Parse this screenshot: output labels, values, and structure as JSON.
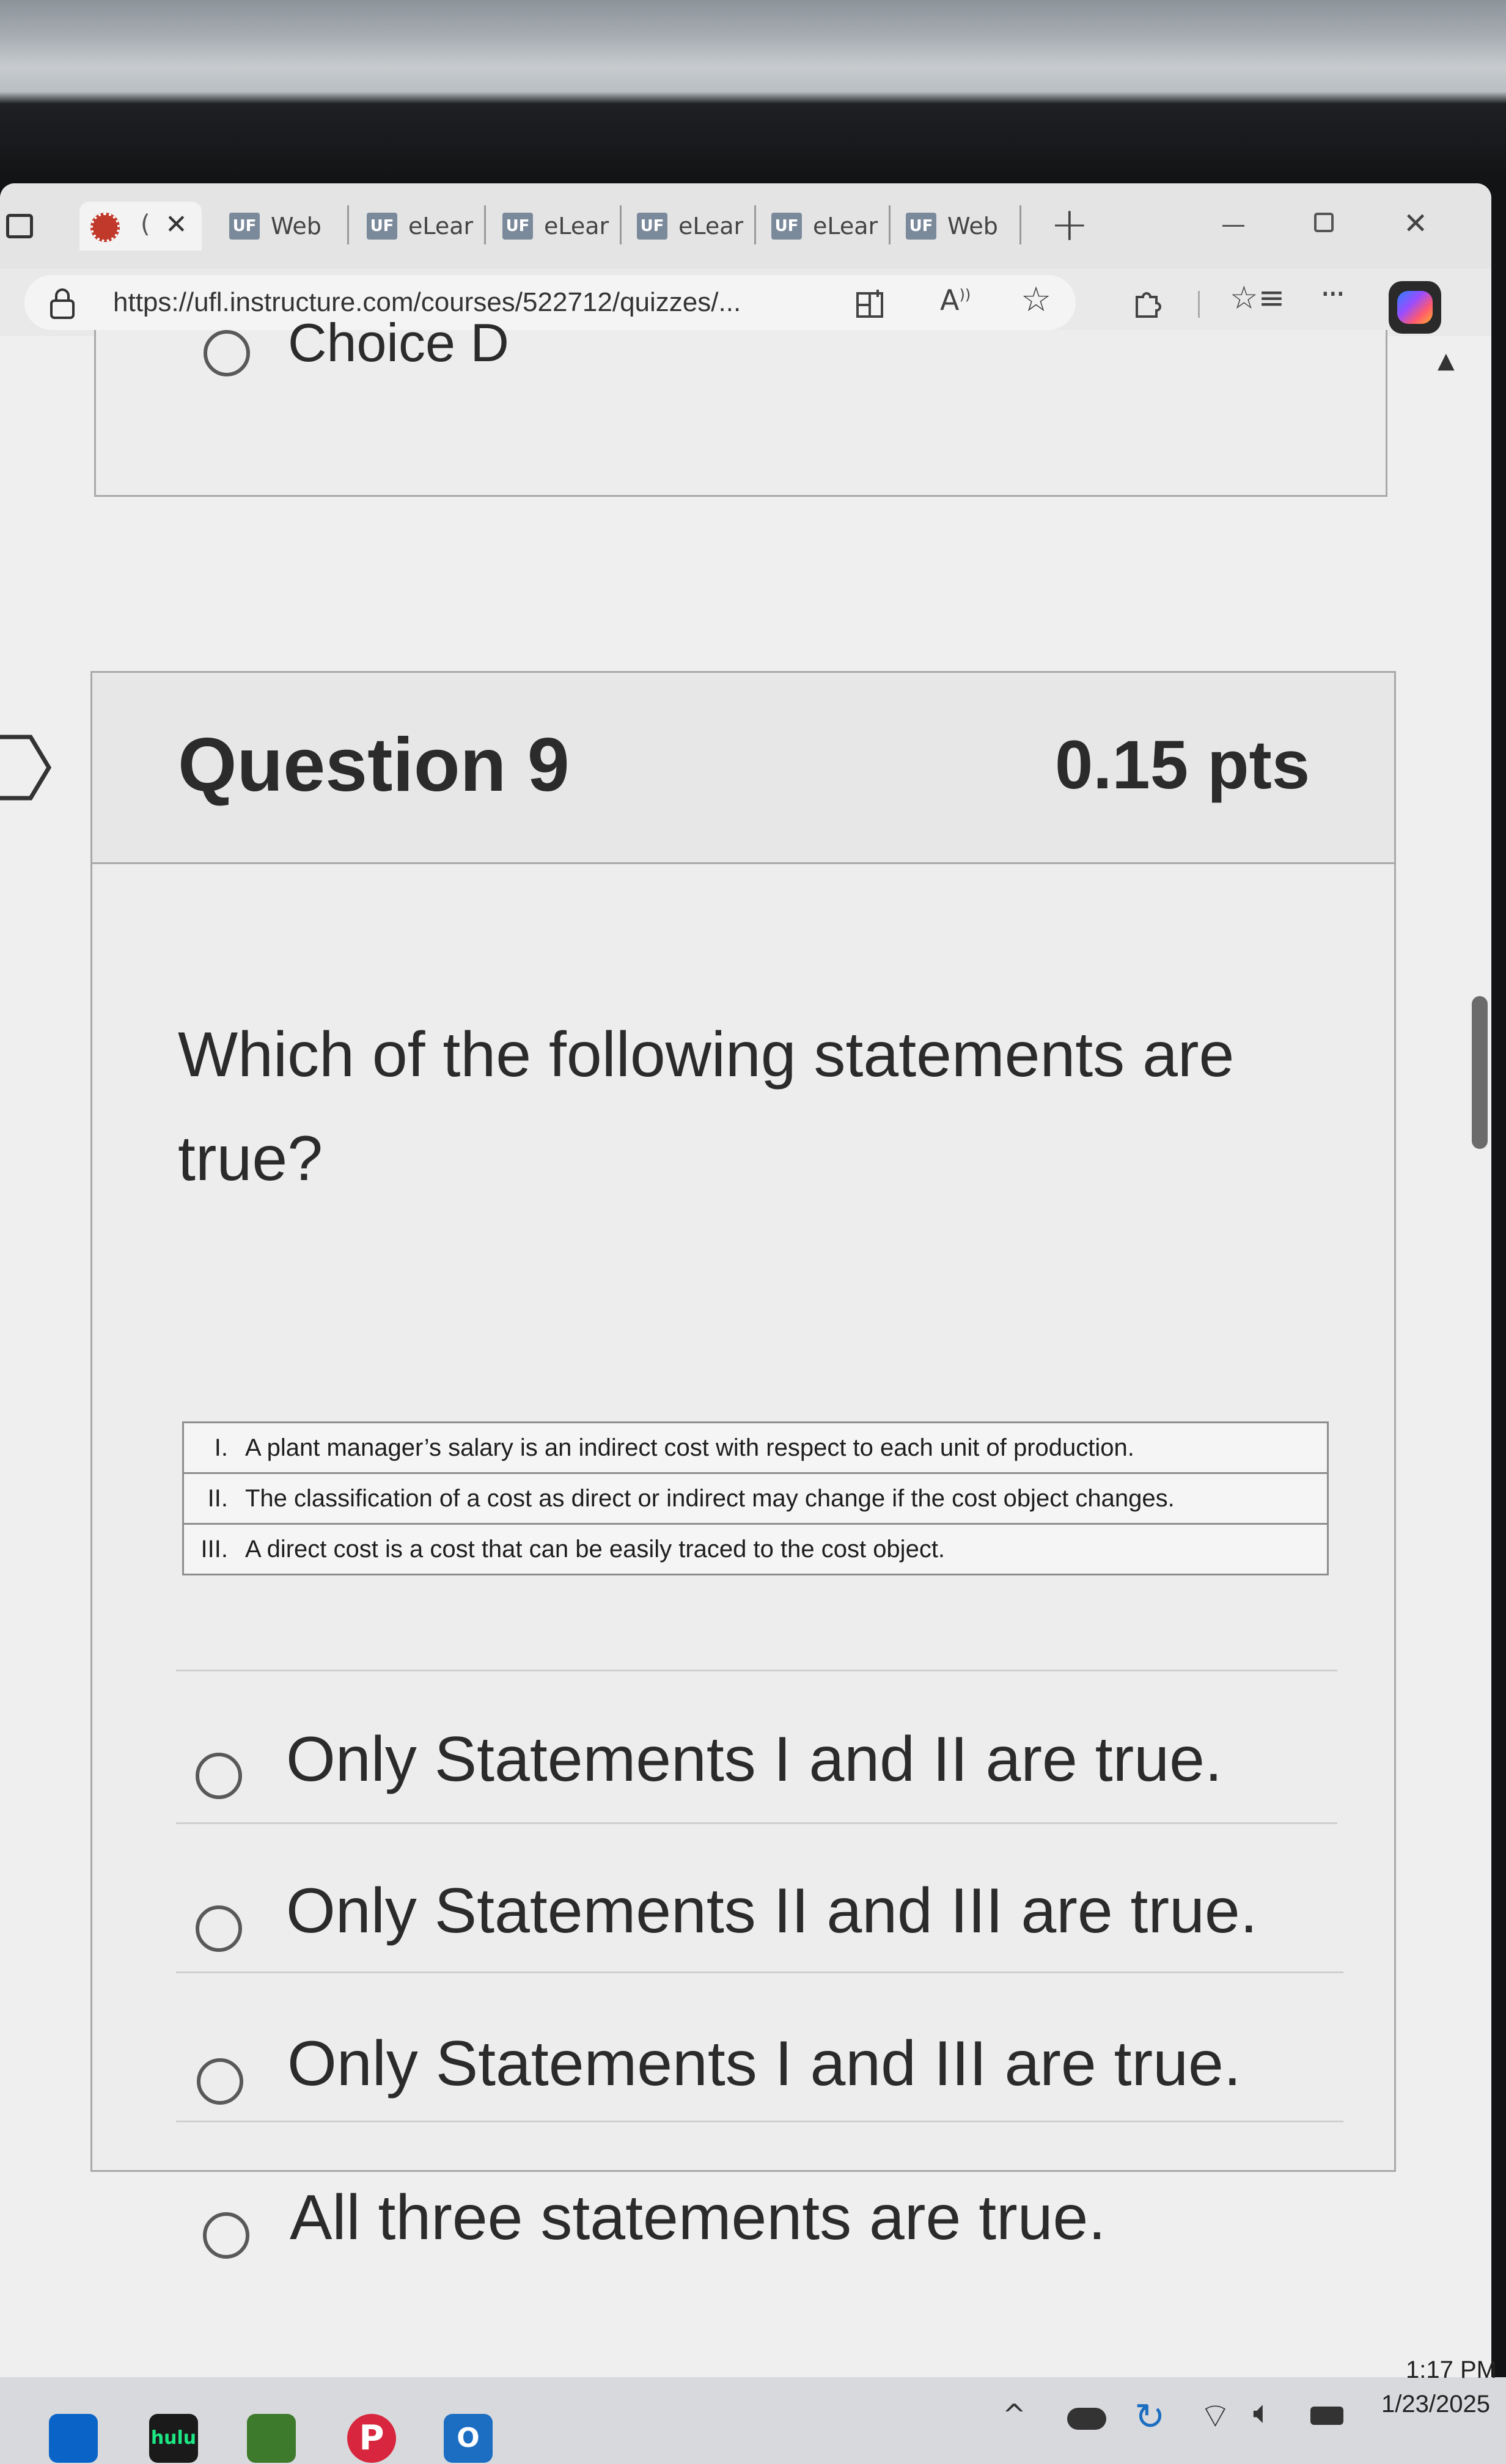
{
  "browser": {
    "tabs": [
      {
        "label": "",
        "active": true
      },
      {
        "label": "Web",
        "badge": "UF"
      },
      {
        "label": "eLear",
        "badge": "UF"
      },
      {
        "label": "eLear",
        "badge": "UF"
      },
      {
        "label": "eLear",
        "badge": "UF"
      },
      {
        "label": "eLear",
        "badge": "UF"
      },
      {
        "label": "Web",
        "badge": "UF"
      }
    ],
    "url": "https://ufl.instructure.com/courses/522712/quizzes/...",
    "new_tab_symbol": "+"
  },
  "quiz": {
    "previous_choice": "Choice D",
    "question_title": "Question 9",
    "points": "0.15 pts",
    "prompt": "Which of the following statements are true?",
    "statements": [
      {
        "num": "I.",
        "text": "A plant manager’s salary is an indirect cost with respect to each unit of production."
      },
      {
        "num": "II.",
        "text": "The classification of a cost as direct or indirect may change if the cost object changes."
      },
      {
        "num": "III.",
        "text": "A direct cost is a cost that can be easily traced to the cost object."
      }
    ],
    "answers": [
      "Only Statements I and II are true.",
      "Only Statements II and III are true.",
      "Only Statements I and III are true.",
      "All three statements are true."
    ]
  },
  "taskbar": {
    "time": "1:17 PM",
    "date": "1/23/2025",
    "hulu_label": "hulu"
  },
  "colors": {
    "accent": "#7b8a9b",
    "pinterest": "#d7263d",
    "outlook": "#1b6ec2"
  }
}
